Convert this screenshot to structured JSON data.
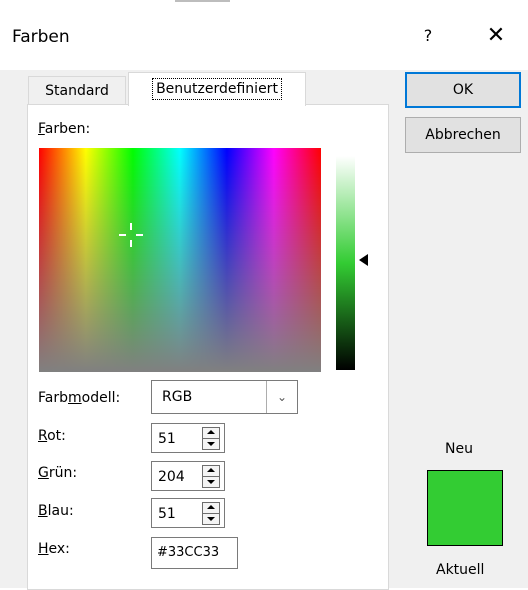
{
  "window": {
    "title": "Farben",
    "help": "?",
    "close": "✕"
  },
  "tabs": [
    {
      "label": "Standard",
      "selected": false
    },
    {
      "label": "Benutzerdefiniert",
      "selected": true
    }
  ],
  "picker": {
    "label_prefix": "F",
    "label_rest": "arben:",
    "luminance_color": "#33cc33"
  },
  "model": {
    "label_a": "Farb",
    "label_u": "m",
    "label_b": "odell:",
    "value": "RGB"
  },
  "fields": {
    "red": {
      "label_u": "R",
      "label_rest": "ot:",
      "value": "51"
    },
    "green": {
      "label_u": "G",
      "label_rest": "rün:",
      "value": "204"
    },
    "blue": {
      "label_u": "B",
      "label_rest": "lau:",
      "value": "51"
    },
    "hex": {
      "label_u": "H",
      "label_rest": "ex:",
      "value": "#33CC33"
    }
  },
  "buttons": {
    "ok": "OK",
    "cancel": "Abbrechen"
  },
  "preview": {
    "new_label": "Neu",
    "current_label": "Aktuell",
    "color": "#33cc33"
  }
}
